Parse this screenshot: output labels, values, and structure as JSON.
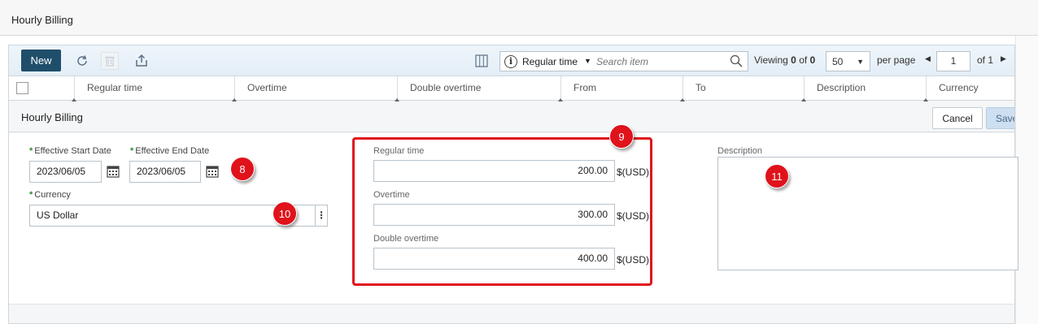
{
  "page": {
    "title": "Hourly Billing"
  },
  "toolbar": {
    "new_label": "New",
    "search": {
      "filter_label": "Regular time",
      "placeholder": "Search item"
    },
    "viewing": {
      "prefix": "Viewing",
      "start": "0",
      "of_word": "of",
      "total": "0"
    },
    "per_page": {
      "value": "50",
      "label": "per page"
    },
    "pagination": {
      "current": "1",
      "of_label": "of 1"
    }
  },
  "grid": {
    "columns": [
      "Regular time",
      "Overtime",
      "Double overtime",
      "From",
      "To",
      "Description",
      "Currency"
    ]
  },
  "form": {
    "title": "Hourly Billing",
    "cancel_label": "Cancel",
    "save_label": "Save",
    "effective_start": {
      "label": "Effective Start Date",
      "value": "2023/06/05"
    },
    "effective_end": {
      "label": "Effective End Date",
      "value": "2023/06/05"
    },
    "currency": {
      "label": "Currency",
      "value": "US Dollar"
    },
    "regular_time": {
      "label": "Regular time",
      "value": "200.00",
      "unit": "$(USD)"
    },
    "overtime": {
      "label": "Overtime",
      "value": "300.00",
      "unit": "$(USD)"
    },
    "double_overtime": {
      "label": "Double overtime",
      "value": "400.00",
      "unit": "$(USD)"
    },
    "description": {
      "label": "Description",
      "value": ""
    }
  },
  "annotations": {
    "callouts": [
      "8",
      "9",
      "10",
      "11"
    ],
    "color": "#e0121b"
  },
  "colors": {
    "primary_button": "#1f4e6b",
    "required_marker": "#2e8b2e",
    "save_button": "#cddff0"
  },
  "icons": [
    "refresh-icon",
    "delete-icon",
    "export-icon",
    "columns-icon",
    "info-icon",
    "search-icon",
    "calendar-icon",
    "more-vertical-icon"
  ]
}
